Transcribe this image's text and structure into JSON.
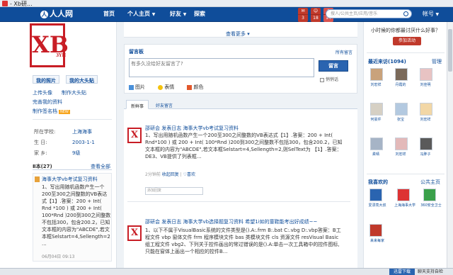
{
  "window": {
    "title": "- Xb研..."
  },
  "nav": {
    "logo": "人人网",
    "links": [
      "首页",
      "个人主页",
      "好友",
      "探索"
    ],
    "badges": [
      "3",
      "18",
      "14"
    ],
    "search_placeholder": "搜人/公共主页/应用/音乐",
    "account": "帐号"
  },
  "profile": {
    "seal_text": "XB",
    "seal_sub": "3YH",
    "tab_photos": "我的照片",
    "tab_bigavatar": "我的大头贴",
    "links": [
      "上传头像",
      "制作大头贴",
      "完善我的资料",
      "制作签名档"
    ],
    "new_badge": "NEW",
    "school_label": "所在学校:",
    "school": "上海海事",
    "birth_label": "生    日:",
    "birth": "2003-1-1",
    "home_label": "家    乡:",
    "home": "9级"
  },
  "share": {
    "header": "Ⅱ本(27)",
    "view_all": "查看全部",
    "title": "海事大学vb考试复习资料",
    "body": "1、写出用随机函数产生一个200至300之间整数的VB表达式【1】.答案：200 + Int( Rnd *100 ) 或 200 + Int( 100*Rnd )200到300之间整数不包括300，包含200.2，已知文本框的内容为\"ABCDE\",若文本框Selstart=4,Sellength=2 ...",
    "date": "06月04日 09:13"
  },
  "middle": {
    "view_more": "查看更多 ▾",
    "guestbook_header": "留言板",
    "guestbook_all": "所有留言",
    "guestbook_placeholder": "有多久没给好友留言了?",
    "post_button": "留言",
    "whisper": "悄悄话",
    "tools": [
      "图片",
      "表情",
      "颜色"
    ],
    "tabs": [
      "新鲜事",
      "好友留言"
    ]
  },
  "feed": [
    {
      "head": "邵研会  发表日志  海事大学vb考试复习资料",
      "body": "1、写出用随机函数产生一个200至300之间整数的VB表达式【1】.答案：200 + Int( Rnd*100 ) 或 200 + Int( 100*Rnd )200到300之间整数不包括300，包含200.2，已知文本框的内容为\"ABCDE\",若文本框Selstart=4,Sellength=2,则SelText为 【1】.答案：DE3、VB提供了列表框...",
      "time": "2分钟前",
      "actions": [
        "收起回复",
        "喜欢"
      ],
      "comment_placeholder": "添加回复"
    },
    {
      "head": "邵研会  发表日志  海事大学vb选择题复习资料 希望1i如的童鞋能考出好成绩~~",
      "body": "1、以下不属于VisualBasic系统的文件类型是().A:.frm B:.bat C:.vbg D:.vbp答案：B工程文件 vbp 窗体文件 frm 程序模块文件 bas 类模块文件 cls 资源文件 resVisual Basic组工程文件 vbg2、下列关于控件画出的常过错误的是().A:单击一次工具箱中的控件图标,只能在窗体上画出一个相应的控件B...",
      "time": "",
      "actions": [],
      "comment_placeholder": ""
    }
  ],
  "right": {
    "promo": "小时候的你都最讨厌什么好事？",
    "promo_button": "参加活动",
    "visitors_header": "最近来访(1094)",
    "visitors_manage": "管理",
    "visitors": [
      "刘宏祥",
      "丹霞的",
      "刘佳明",
      "何豪芹",
      "张宝",
      "刘宏祥",
      "柔晴",
      "刘宏祥",
      "冯胖子"
    ],
    "fav_header": "我喜欢的",
    "fav_right": "公共主页",
    "favs": [
      "爱漂亮大叔",
      "上海海事大学",
      "360安全卫士",
      "来来每家"
    ]
  },
  "statusbar": {
    "download": "迅雷下载",
    "checker": "聊天支持自检"
  }
}
